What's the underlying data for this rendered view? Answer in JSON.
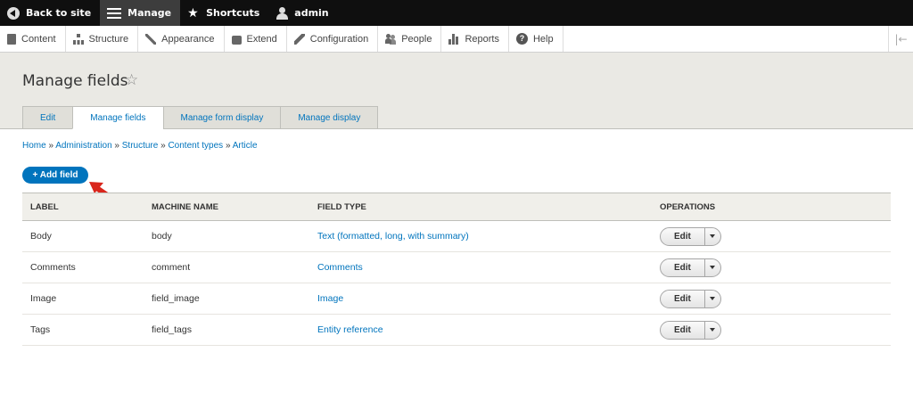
{
  "toolbar": {
    "back": "Back to site",
    "manage": "Manage",
    "shortcuts": "Shortcuts",
    "user": "admin"
  },
  "tray": {
    "items": [
      {
        "label": "Content",
        "icon": "document-icon"
      },
      {
        "label": "Structure",
        "icon": "structure-icon"
      },
      {
        "label": "Appearance",
        "icon": "brush-icon"
      },
      {
        "label": "Extend",
        "icon": "puzzle-icon"
      },
      {
        "label": "Configuration",
        "icon": "wrench-icon"
      },
      {
        "label": "People",
        "icon": "people-icon"
      },
      {
        "label": "Reports",
        "icon": "bar-chart-icon"
      },
      {
        "label": "Help",
        "icon": "help-icon"
      }
    ],
    "collapse_glyph": "|←"
  },
  "page": {
    "title": "Manage fields",
    "tabs": [
      "Edit",
      "Manage fields",
      "Manage form display",
      "Manage display"
    ],
    "active_tab": "Manage fields"
  },
  "breadcrumb": [
    "Home",
    "Administration",
    "Structure",
    "Content types",
    "Article"
  ],
  "breadcrumb_sep": "»",
  "add_field": "+ Add field",
  "table": {
    "headers": [
      "LABEL",
      "MACHINE NAME",
      "FIELD TYPE",
      "OPERATIONS"
    ],
    "rows": [
      {
        "label": "Body",
        "machine": "body",
        "type": "Text (formatted, long, with summary)",
        "op": "Edit"
      },
      {
        "label": "Comments",
        "machine": "comment",
        "type": "Comments",
        "op": "Edit"
      },
      {
        "label": "Image",
        "machine": "field_image",
        "type": "Image",
        "op": "Edit"
      },
      {
        "label": "Tags",
        "machine": "field_tags",
        "type": "Entity reference",
        "op": "Edit"
      }
    ]
  },
  "colors": {
    "accent": "#0074bd",
    "toolbar_bg": "#0f0f0f",
    "header_bg": "#eae9e4",
    "annotation_arrow": "#d9261c"
  }
}
